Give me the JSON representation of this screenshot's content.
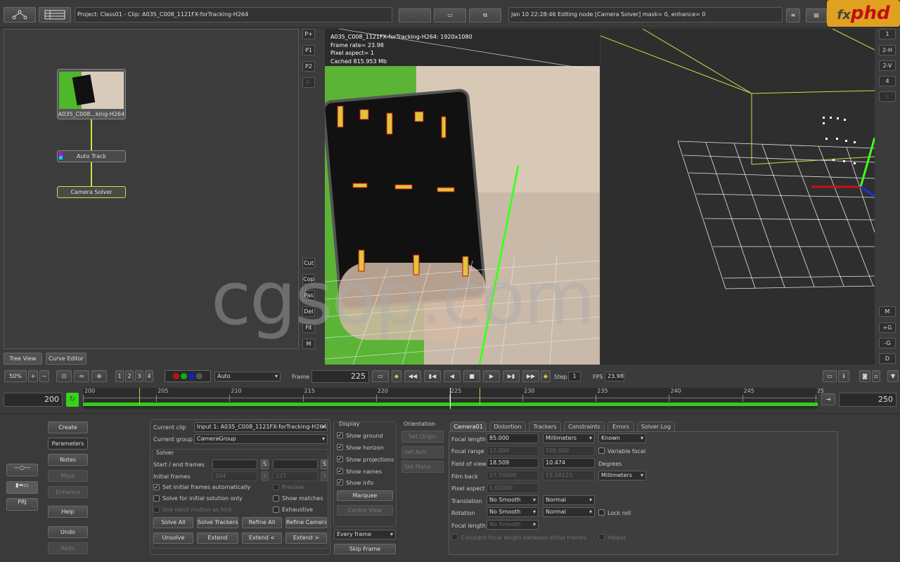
{
  "header": {
    "project": "Project: Class01 - Clip: A035_C008_1121FX-forTracking-H264",
    "status": "Jan 10 22:28:46 Editing node [Camera Solver] mask= 0, enhance= 0",
    "logo": "phd",
    "logo_prefix": "fx"
  },
  "node_graph": {
    "clip_node": "A035_C008...king-H264",
    "track_node": "Auto Track",
    "solver_node": "Camera Solver",
    "side_buttons": [
      "P+",
      "P1",
      "P2",
      "P-"
    ],
    "edit_buttons": [
      "Cut",
      "Cop",
      "Pas",
      "Del",
      "Fit",
      "M"
    ],
    "tabs": [
      "Tree View",
      "Curve Editor"
    ]
  },
  "viewer": {
    "info": [
      "A035_C008_1121FX-forTracking-H264: 1920x1080",
      "Frame rate= 23.98",
      "Pixel aspect= 1",
      "Cached 815.953 Mb"
    ],
    "layout_buttons": [
      "1",
      "2-H",
      "2-V",
      "4",
      "L"
    ],
    "bottom_buttons": [
      "M",
      "+G",
      "-G",
      "D"
    ]
  },
  "watermark": "cgsop.com",
  "timeline": {
    "zoom": "50%",
    "pages": [
      "1",
      "2",
      "3",
      "4"
    ],
    "channel": "Auto",
    "frame_label": "Frame",
    "frame": "225",
    "step_label": "Step",
    "step": "1",
    "fps_label": "FPS",
    "fps": "23.98",
    "start": "200",
    "end": "250",
    "ticks": [
      "200",
      "205",
      "210",
      "215",
      "220",
      "225",
      "230",
      "235",
      "240",
      "245",
      "25"
    ]
  },
  "left_buttons": [
    "Create",
    "Parameters",
    "Notes",
    "Mask",
    "Enhance",
    "Help",
    "Undo",
    "Redo"
  ],
  "solver": {
    "current_clip_label": "Current clip",
    "current_clip": "Input 1: A035_C008_1121FX-forTracking-H264",
    "current_group_label": "Current group",
    "current_group": "CameraGroup",
    "section": "Solver",
    "start_end_label": "Start / end frames",
    "initial_frames_label": "Initial frames",
    "initial_a": "204",
    "initial_b": "227",
    "s_label": "S",
    "set_initial": "Set initial frames automatically",
    "solve_initial": "Solve for initial solution only",
    "use_input": "Use input motion as hint",
    "preview": "Preview",
    "show_matches": "Show matches",
    "exhaustive": "Exhaustive",
    "buttons": [
      "Solve All",
      "Solve Trackers",
      "Refine All",
      "Refine Camera",
      "Unsolve",
      "Extend",
      "Extend <",
      "Extend >"
    ]
  },
  "display": {
    "title": "Display",
    "items": [
      "Show ground",
      "Show horizon",
      "Show projections",
      "Show names",
      "Show info"
    ],
    "marquee": "Marquee",
    "centre": "Centre View",
    "every": "Every frame",
    "skip": "Skip Frame"
  },
  "orientation": {
    "title": "Orientation",
    "buttons": [
      "Set Origin",
      "Set Axis",
      "Set Plane"
    ]
  },
  "camera": {
    "tabs": [
      "Camera01",
      "Distortion",
      "Trackers",
      "Constraints",
      "Errors",
      "Solver Log"
    ],
    "focal_length_label": "Focal length",
    "focal_length": "85.000",
    "focal_unit": "Millimeters",
    "focal_mode": "Known",
    "focal_range_label": "Focal range",
    "range_a": "12.000",
    "range_b": "105.000",
    "variable_focal": "Variable focal",
    "fov_label": "Field of view",
    "fov_a": "18.509",
    "fov_b": "10.474",
    "degrees": "Degrees",
    "film_back_label": "Film back",
    "film_a": "27.70000",
    "film_b": "15.58125",
    "film_unit": "Millimeters",
    "pixel_aspect_label": "Pixel aspect",
    "pixel_aspect": "1.00000",
    "translation_label": "Translation",
    "translation": "No Smooth",
    "translation_mode": "Normal",
    "rotation_label": "Rotation",
    "rotation": "No Smooth",
    "rotation_mode": "Normal",
    "lock_roll": "Lock roll",
    "focal_label2": "Focal length",
    "focal_smooth": "No Smooth",
    "constant": "Constant focal length between initial frames",
    "helper": "Helper"
  },
  "colors": {
    "accent": "#c8d23c",
    "green": "#39d11a",
    "panel": "#3b3b3b"
  }
}
